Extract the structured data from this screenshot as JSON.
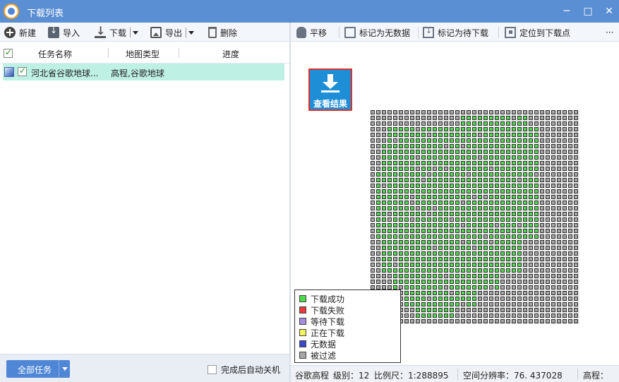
{
  "window": {
    "title": "下载列表",
    "controls": [
      "─",
      "□",
      "✕"
    ]
  },
  "left_toolbar": {
    "new": "新建",
    "import": "导入",
    "download": "下载",
    "export": "导出",
    "delete": "删除"
  },
  "right_toolbar": {
    "pan": "平移",
    "mark_no_data": "标记为无数据",
    "mark_pending": "标记为待下载",
    "locate": "定位到下载点",
    "more": "···"
  },
  "table": {
    "columns": [
      "任务名称",
      "地图类型",
      "进度"
    ],
    "rows": [
      {
        "name": "河北省谷歌地球...",
        "map_type": "高程,谷歌地球",
        "progress": ""
      }
    ]
  },
  "footer": {
    "all_tasks": "全部任务",
    "auto_shutdown": "完成后自动关机"
  },
  "result_button": {
    "label": "查看结果"
  },
  "legend": {
    "items": [
      {
        "label": "下载成功",
        "color": "#4cd94c"
      },
      {
        "label": "下载失败",
        "color": "#e83a3a"
      },
      {
        "label": "等待下载",
        "color": "#a58ee0"
      },
      {
        "label": "正在下载",
        "color": "#f2f25a"
      },
      {
        "label": "无数据",
        "color": "#3b46c8"
      },
      {
        "label": "被过滤",
        "color": "#a6a6a6"
      }
    ]
  },
  "statusbar": {
    "map_name": "谷歌高程",
    "level": "级别：12",
    "scale": "比例尺：1:288895",
    "resolution": "空间分辨率：76. 437028",
    "elevation": "高程："
  },
  "tile_grid": {
    "columns": 37,
    "rows": 38,
    "success_color": "#4cd94c",
    "filtered_color": "#a6a6a6"
  }
}
